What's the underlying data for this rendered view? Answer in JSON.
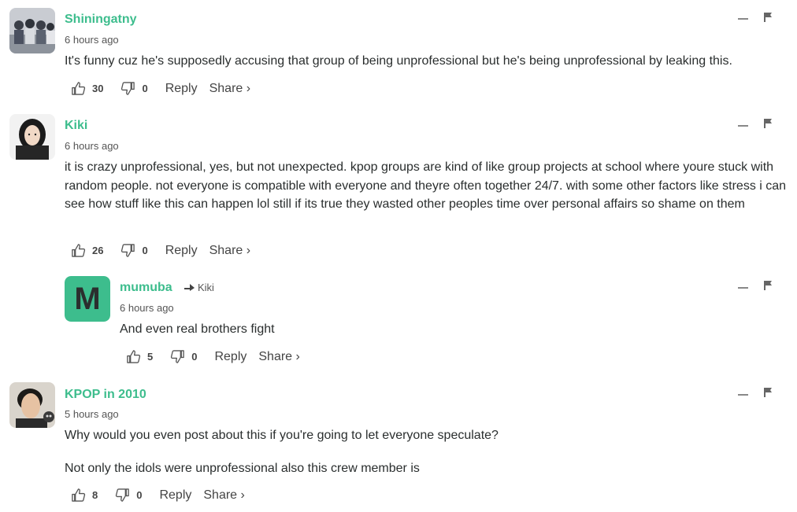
{
  "comments": [
    {
      "author": "Shiningatny",
      "time": "6 hours ago",
      "body": [
        "It's funny cuz he's supposedly accusing that group of being unprofessional but he's being unprofessional by leaking this."
      ],
      "upvotes": "30",
      "downvotes": "0",
      "reply_label": "Reply",
      "share_label": "Share ›"
    },
    {
      "author": "Kiki",
      "time": "6 hours ago",
      "body": [
        "it is crazy unprofessional, yes, but not unexpected. kpop groups are kind of like group projects at school where youre stuck with random people. not everyone is compatible with everyone and theyre often together 24/7. with some other factors like stress i can see how stuff like this can happen lol still if its true they wasted other peoples time over personal affairs so shame on them"
      ],
      "upvotes": "26",
      "downvotes": "0",
      "reply_label": "Reply",
      "share_label": "Share ›"
    },
    {
      "author": "mumuba",
      "avatar_letter": "M",
      "in_reply_to": "Kiki",
      "time": "6 hours ago",
      "body": [
        "And even real brothers fight"
      ],
      "upvotes": "5",
      "downvotes": "0",
      "reply_label": "Reply",
      "share_label": "Share ›"
    },
    {
      "author": "KPOP in 2010",
      "time": "5 hours ago",
      "body": [
        "Why would you even post about this if you're going to let everyone speculate?",
        "Not only the idols were unprofessional also this crew member is"
      ],
      "upvotes": "8",
      "downvotes": "0",
      "reply_label": "Reply",
      "share_label": "Share ›"
    }
  ],
  "colors": {
    "author": "#3dbd8d",
    "avatar_bg": "#3dbd8d",
    "text": "#2a2e2e",
    "meta": "#555555"
  },
  "icons": [
    "thumbs-up-icon",
    "thumbs-down-icon",
    "minimize-icon",
    "flag-icon",
    "reply-arrow-icon"
  ]
}
